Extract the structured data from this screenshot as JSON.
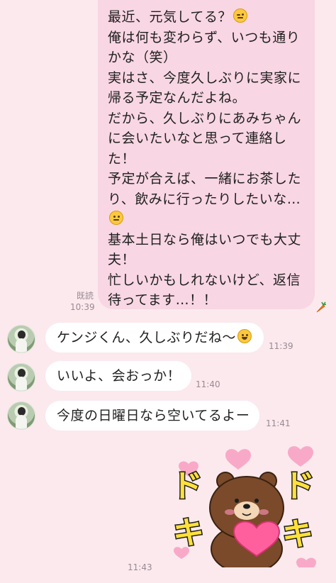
{
  "outgoing": {
    "lines": [
      "最近、元気してる？",
      "俺は何も変わらず、いつも通り",
      "かな（笑）",
      "実はさ、今度久しぶりに実家に",
      "帰る予定なんだよね。",
      "だから、久しぶりにあみちゃん",
      "に会いたいなと思って連絡し",
      "た！",
      "予定が合えば、一緒にお茶した",
      "り、飲みに行ったりしたいな…",
      "",
      "基本土日なら俺はいつでも大丈",
      "夫！",
      "忙しいかもしれないけど、返信",
      "待ってます…！！"
    ],
    "read_label": "既読",
    "time": "10:39",
    "carrot_icon": "carrot-sticker-icon"
  },
  "incoming": [
    {
      "text": "ケンジくん、久しぶりだね〜",
      "time": "11:39",
      "emoji": "smiling-face-emoji"
    },
    {
      "text": "いいよ、会おっか！",
      "time": "11:40"
    },
    {
      "text": "今度の日曜日なら空いてるよー",
      "time": "11:41"
    }
  ],
  "sticker": {
    "time": "11:43",
    "text_left": [
      "ド",
      "キ"
    ],
    "text_right": [
      "ド",
      "キ"
    ],
    "character": "brown-bear-holding-heart",
    "colors": {
      "text": "#ffe13a",
      "outline": "#1c1c1c",
      "heart": "#ff5f9d",
      "bear": "#7a4a2a"
    }
  },
  "colors": {
    "background": "#fbe9ee",
    "outgoing_bubble": "#f8d6e3",
    "incoming_bubble": "#ffffff"
  }
}
